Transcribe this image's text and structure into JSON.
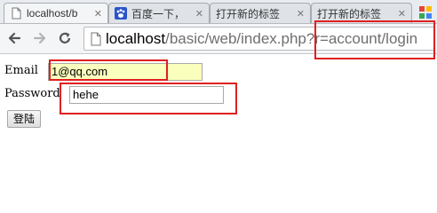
{
  "browser": {
    "tabs": [
      {
        "title": "localhost/b",
        "active": true,
        "icon": "page-icon"
      },
      {
        "title": "百度一下，",
        "active": false,
        "icon": "baidu-paw-icon"
      },
      {
        "title": "打开新的标签",
        "active": false,
        "icon": "none"
      },
      {
        "title": "打开新的标签",
        "active": false,
        "icon": "none"
      }
    ],
    "address": {
      "host": "localhost",
      "rest": "/basic/web/index.php?r=account/login"
    }
  },
  "form": {
    "email_label": "Email",
    "email_value": "1@qq.com",
    "password_label": "Password",
    "password_value": "hehe",
    "submit_label": "登陆"
  },
  "colors": {
    "highlight": "#e02020",
    "autofill": "#faffbd"
  }
}
